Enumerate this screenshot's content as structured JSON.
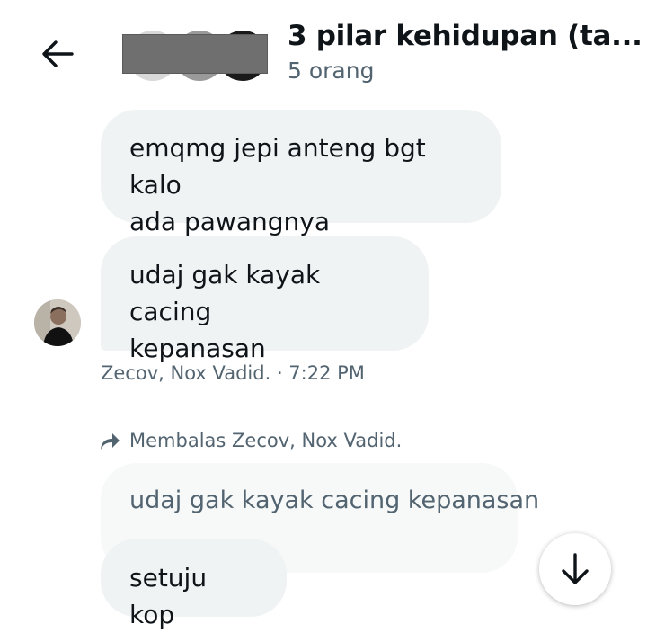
{
  "header": {
    "title": "3 pilar kehidupan (ta...",
    "subtitle": "5 orang"
  },
  "icons": {
    "back": "arrow-left-icon",
    "reply": "reply-arrow-icon",
    "scroll": "arrow-down-icon"
  },
  "messages": [
    {
      "text": "emqmg jepi anteng bgt kalo\nada pawangnya"
    },
    {
      "text": "udaj gak kayak cacing\nkepanasan"
    }
  ],
  "meta": "Zecov, Nox Vadid. · 7:22 PM",
  "reply": {
    "label": "Membalas Zecov, Nox Vadid.",
    "quoted": "udaj gak kayak cacing kepanasan",
    "text": "setuju kop"
  }
}
